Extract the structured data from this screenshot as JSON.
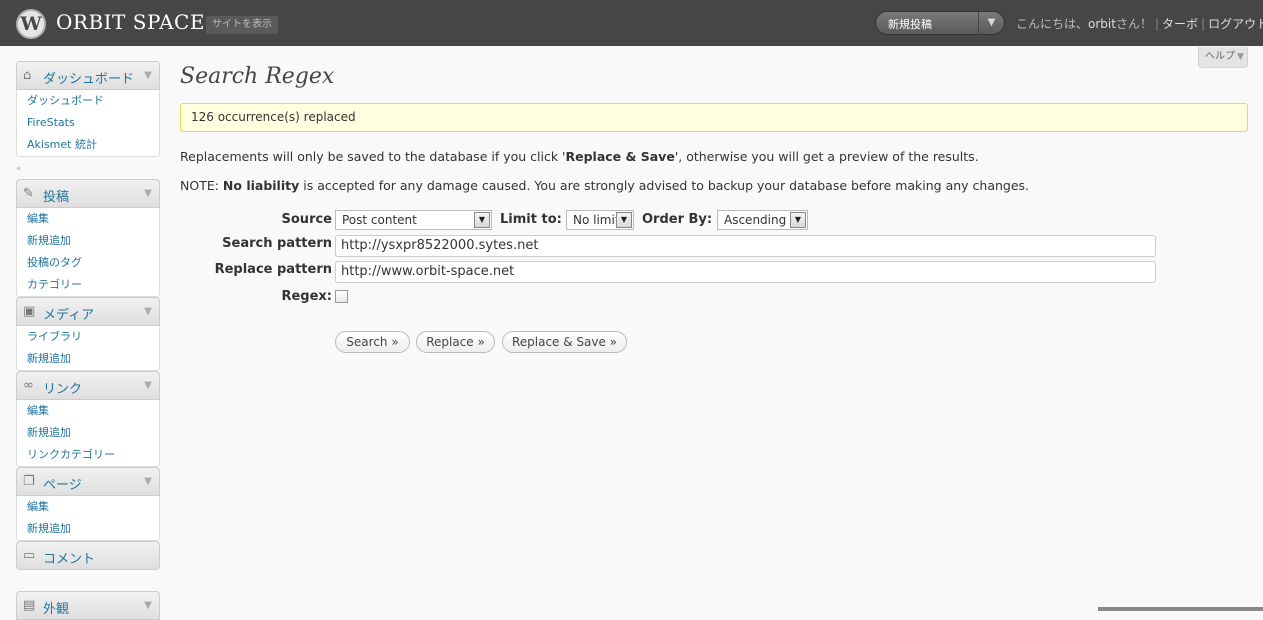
{
  "header": {
    "site_title": "ORBIT SPACE",
    "view_site": "サイトを表示",
    "favorite_action": "新規投稿",
    "greeting_prefix": "こんにちは、",
    "username": "orbit",
    "greeting_suffix": "さん！",
    "turbo": "ターボ",
    "logout": "ログアウト"
  },
  "help": {
    "label": "ヘルプ"
  },
  "sidebar": {
    "dashboard": {
      "label": "ダッシュボード",
      "items": [
        "ダッシュボード",
        "FireStats",
        "Akismet 統計"
      ]
    },
    "posts": {
      "label": "投稿",
      "items": [
        "編集",
        "新規追加",
        "投稿のタグ",
        "カテゴリー"
      ]
    },
    "media": {
      "label": "メディア",
      "items": [
        "ライブラリ",
        "新規追加"
      ]
    },
    "links": {
      "label": "リンク",
      "items": [
        "編集",
        "新規追加",
        "リンクカテゴリー"
      ]
    },
    "pages": {
      "label": "ページ",
      "items": [
        "編集",
        "新規追加"
      ]
    },
    "comments": {
      "label": "コメント"
    },
    "appearance": {
      "label": "外観"
    }
  },
  "main": {
    "title": "Search Regex",
    "notice": "126 occurrence(s) replaced",
    "info_prefix": "Replacements will only be saved to the database if you click '",
    "info_bold": "Replace & Save",
    "info_suffix": "', otherwise you will get a preview of the results.",
    "note_prefix": "NOTE: ",
    "note_bold": "No liability",
    "note_suffix": " is accepted for any damage caused. You are strongly advised to backup your database before making any changes."
  },
  "form": {
    "source_label": "Source",
    "source_value": "Post content",
    "limit_label": "Limit to:",
    "limit_value": "No limit",
    "order_label": "Order By:",
    "order_value": "Ascending",
    "search_label": "Search pattern",
    "search_value": "http://ysxpr8522000.sytes.net",
    "replace_label": "Replace pattern",
    "replace_value": "http://www.orbit-space.net",
    "regex_label": "Regex:",
    "regex_checked": false
  },
  "buttons": {
    "search": "Search »",
    "replace": "Replace »",
    "replace_save": "Replace & Save »"
  },
  "icons": {
    "dashboard": "house-icon",
    "posts": "pushpin-icon",
    "media": "media-icon",
    "links": "chain-link-icon",
    "pages": "pages-icon",
    "comments": "speech-bubble-icon",
    "appearance": "appearance-icon"
  },
  "colors": {
    "header_bg": "#464646",
    "link": "#21759b",
    "notice_bg": "#ffffe0",
    "notice_border": "#e6db55"
  }
}
